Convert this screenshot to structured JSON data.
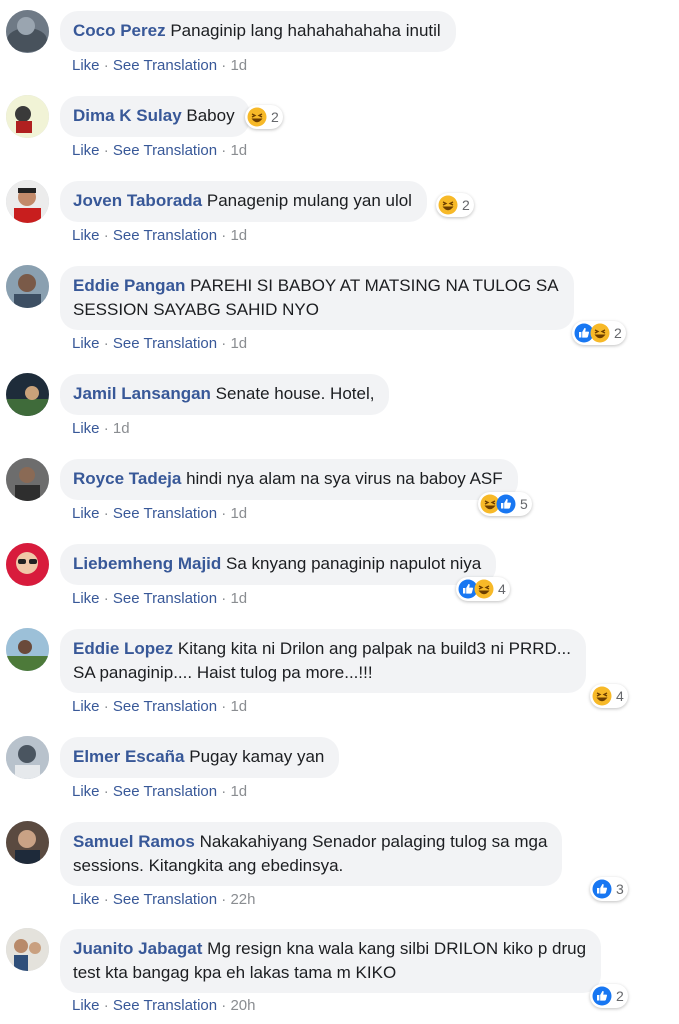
{
  "comments": [
    {
      "author": "Coco Perez",
      "text": "Panaginip lang hahahahahaha inutil",
      "like": "Like",
      "translate": "See Translation",
      "time": "1d",
      "reactions": [],
      "reaction_count": ""
    },
    {
      "author": "Dima K Sulay",
      "text": "Baboy",
      "like": "Like",
      "translate": "See Translation",
      "time": "1d",
      "reactions": [
        "haha-icon"
      ],
      "reaction_count": "2"
    },
    {
      "author": "Joven Taborada",
      "text": "Panagenip mulang yan ulol",
      "like": "Like",
      "translate": "See Translation",
      "time": "1d",
      "reactions": [
        "haha-icon"
      ],
      "reaction_count": "2"
    },
    {
      "author": "Eddie Pangan",
      "text": "PAREHI SI BABOY AT MATSING NA TULOG SA",
      "text2": "SESSION SAYABG SAHID NYO",
      "like": "Like",
      "translate": "See Translation",
      "time": "1d",
      "reactions": [
        "like-icon",
        "haha-icon"
      ],
      "reaction_count": "2"
    },
    {
      "author": "Jamil Lansangan",
      "text": "Senate house. Hotel,",
      "like": "Like",
      "time": "1d",
      "reactions": [],
      "reaction_count": ""
    },
    {
      "author": "Royce Tadeja",
      "text": "hindi nya alam na sya virus na baboy ASF",
      "like": "Like",
      "translate": "See Translation",
      "time": "1d",
      "reactions": [
        "haha-icon",
        "like-icon"
      ],
      "reaction_count": "5"
    },
    {
      "author": "Liebemheng Majid",
      "text": "Sa knyang panaginip napulot niya",
      "like": "Like",
      "translate": "See Translation",
      "time": "1d",
      "reactions": [
        "like-icon",
        "haha-icon"
      ],
      "reaction_count": "4"
    },
    {
      "author": "Eddie Lopez",
      "text": "Kitang kita ni Drilon ang palpak na build3 ni PRRD...",
      "text2": "SA panaginip.... Haist tulog pa more...!!!",
      "like": "Like",
      "translate": "See Translation",
      "time": "1d",
      "reactions": [
        "haha-icon"
      ],
      "reaction_count": "4"
    },
    {
      "author": "Elmer Escaña",
      "text": "Pugay kamay yan",
      "like": "Like",
      "translate": "See Translation",
      "time": "1d",
      "reactions": [],
      "reaction_count": ""
    },
    {
      "author": "Samuel Ramos",
      "text": "Nakakahiyang Senador palaging tulog sa mga",
      "text2": "sessions. Kitangkita ang ebedinsya.",
      "like": "Like",
      "translate": "See Translation",
      "time": "22h",
      "reactions": [
        "like-icon"
      ],
      "reaction_count": "3"
    },
    {
      "author": "Juanito Jabagat",
      "text": "Mg resign kna wala kang silbi DRILON kiko p drug",
      "text2": "test kta bangag kpa eh lakas tama m KIKO",
      "like": "Like",
      "translate": "See Translation",
      "time": "20h",
      "reactions": [
        "like-icon"
      ],
      "reaction_count": "2"
    }
  ],
  "separator": "·",
  "colors": {
    "link": "#385898",
    "bubble": "#f2f3f5",
    "meta": "#8a8d91",
    "like_blue": "#1877f2",
    "haha_yellow": "#f7b928"
  }
}
